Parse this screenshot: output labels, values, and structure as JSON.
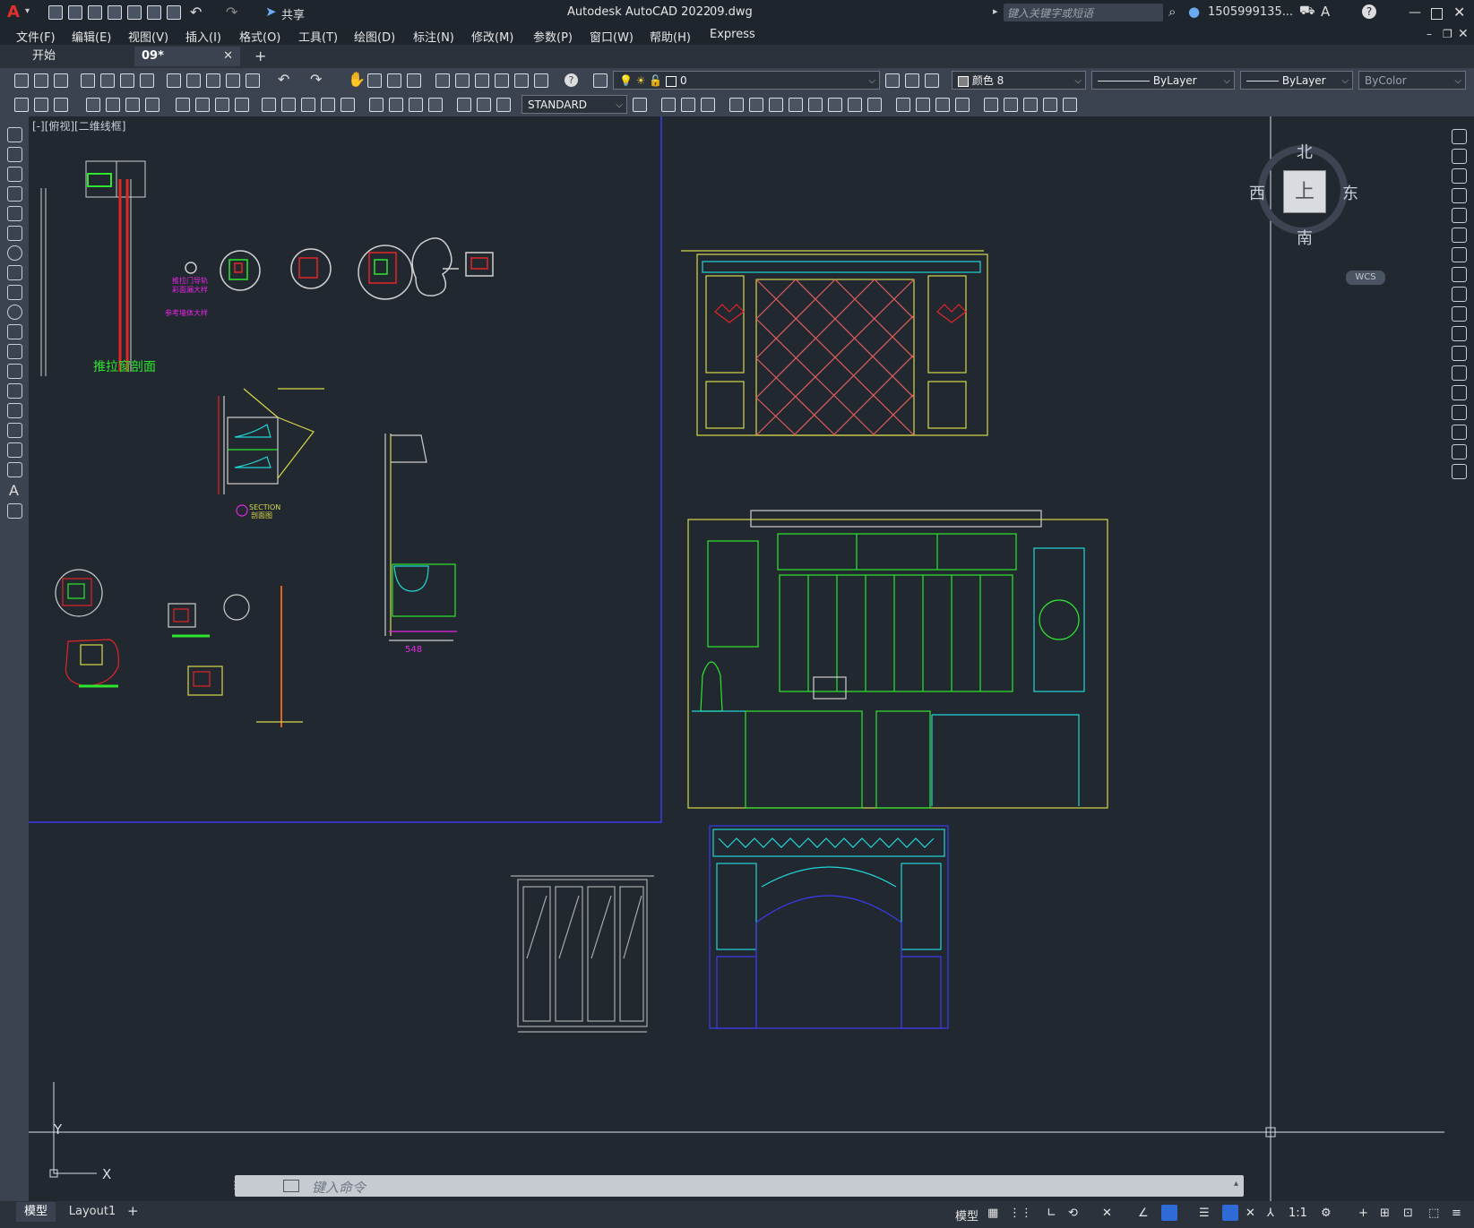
{
  "app": {
    "title": "Autodesk AutoCAD 2022",
    "file": "09.dwg",
    "search_placeholder": "键入关键字或短语",
    "user": "1505999135...",
    "share": "共享"
  },
  "menu": [
    "文件(F)",
    "编辑(E)",
    "视图(V)",
    "插入(I)",
    "格式(O)",
    "工具(T)",
    "绘图(D)",
    "标注(N)",
    "修改(M)",
    "参数(P)",
    "窗口(W)",
    "帮助(H)",
    "Express"
  ],
  "tabs": [
    {
      "label": "开始",
      "active": false
    },
    {
      "label": "09*",
      "active": true
    }
  ],
  "tab_close": "✕",
  "tab_add": "+",
  "properties": {
    "layer": "0",
    "color": "颜色 8",
    "linetype": "ByLayer",
    "lineweight": "ByLayer",
    "plotstyle": "ByColor",
    "text_style": "STANDARD"
  },
  "viewport_label": "[-][俯视][二维线框]",
  "viewcube": {
    "north": "北",
    "south": "南",
    "east": "东",
    "west": "西",
    "top": "上",
    "wcs": "WCS"
  },
  "drawing_text": {
    "window_section": "推拉窗剖面",
    "dimension": "548",
    "section": "SECTION",
    "section_sub": "剖面图",
    "annot_1": "推拉门导轨",
    "annot_2": "彩面漏大样",
    "annot_3": "参考墙体大样"
  },
  "ucs": {
    "x": "X",
    "y": "Y"
  },
  "command": {
    "placeholder": "键入命令"
  },
  "layout_tabs": [
    {
      "label": "模型",
      "active": true
    },
    {
      "label": "Layout1",
      "active": false
    }
  ],
  "layout_add": "+",
  "status": {
    "model": "模型",
    "scale": "1:1"
  },
  "colors": {
    "background": "#212830",
    "ribbon": "#3b4350",
    "accent_blue": "#2f6bd6",
    "drawing_yellow": "#d8d84a",
    "drawing_green": "#2ee62e",
    "drawing_cyan": "#21d6d6",
    "drawing_red": "#e22626",
    "drawing_magenta": "#e626e6",
    "drawing_blue": "#3b3bf0"
  }
}
